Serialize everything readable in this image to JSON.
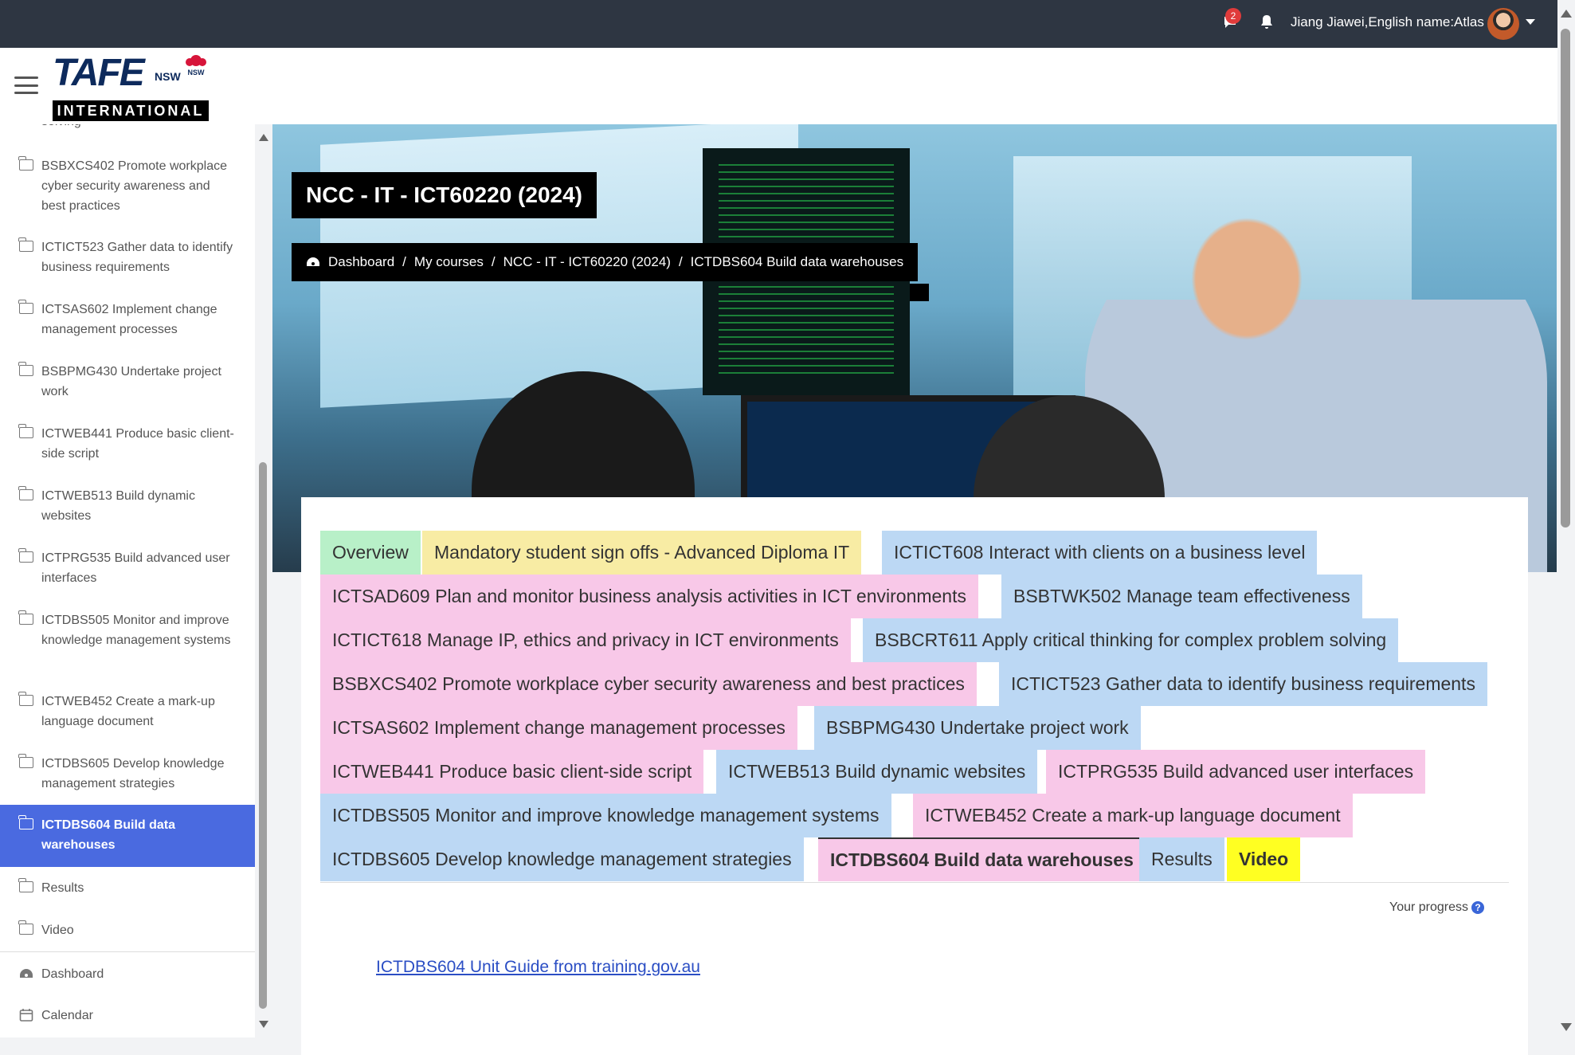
{
  "topbar": {
    "message_badge": "2",
    "user_name": "Jiang Jiawei,English name:Atlas"
  },
  "logo": {
    "brand": "TAFE",
    "nsw": "NSW",
    "international": "INTERNATIONAL"
  },
  "sidebar": {
    "cut_off_text": "solving",
    "items": [
      {
        "label": "BSBXCS402 Promote workplace cyber security awareness and best practices"
      },
      {
        "label": "ICTICT523 Gather data to identify business requirements"
      },
      {
        "label": "ICTSAS602 Implement change management processes"
      },
      {
        "label": "BSBPMG430 Undertake project work"
      },
      {
        "label": "ICTWEB441 Produce basic client-side script"
      },
      {
        "label": "ICTWEB513 Build dynamic websites"
      },
      {
        "label": "ICTPRG535 Build advanced user interfaces"
      },
      {
        "label": "ICTDBS505 Monitor and improve knowledge management systems"
      },
      {
        "label": "ICTWEB452 Create a mark-up language document"
      },
      {
        "label": "ICTDBS605 Develop knowledge management strategies"
      },
      {
        "label": "ICTDBS604 Build data warehouses"
      },
      {
        "label": "Results"
      },
      {
        "label": "Video"
      }
    ],
    "footer": [
      {
        "label": "Dashboard"
      },
      {
        "label": "Calendar"
      }
    ]
  },
  "header": {
    "course_title": "NCC - IT - ICT60220 (2024)",
    "breadcrumb": [
      "Dashboard",
      "My courses",
      "NCC - IT - ICT60220 (2024)",
      "ICTDBS604 Build data warehouses"
    ]
  },
  "tabs": [
    {
      "label": "Overview",
      "color": "#b8f0c8"
    },
    {
      "label": "Mandatory student sign offs - Advanced Diploma IT",
      "color": "#f8eca4"
    },
    {
      "label": "ICTICT608 Interact with clients on a business level",
      "color": "#bcd8f4"
    },
    {
      "label": "ICTSAD609 Plan and monitor business analysis activities in ICT environments",
      "color": "#f8c8e8"
    },
    {
      "label": "BSBTWK502 Manage team effectiveness",
      "color": "#bcd8f4"
    },
    {
      "label": "ICTICT618 Manage IP, ethics and privacy in ICT environments",
      "color": "#f8c8e8"
    },
    {
      "label": "BSBCRT611 Apply critical thinking for complex problem solving",
      "color": "#bcd8f4"
    },
    {
      "label": "BSBXCS402 Promote workplace cyber security awareness and best practices",
      "color": "#f8c8e8"
    },
    {
      "label": "ICTICT523 Gather data to identify business requirements",
      "color": "#bcd8f4"
    },
    {
      "label": "ICTSAS602 Implement change management processes",
      "color": "#f8c8e8"
    },
    {
      "label": "BSBPMG430 Undertake project work",
      "color": "#bcd8f4"
    },
    {
      "label": "ICTWEB441 Produce basic client-side script",
      "color": "#f8c8e8"
    },
    {
      "label": "ICTWEB513 Build dynamic websites",
      "color": "#bcd8f4"
    },
    {
      "label": "ICTPRG535 Build advanced user interfaces",
      "color": "#f8c8e8"
    },
    {
      "label": "ICTDBS505 Monitor and improve knowledge management systems",
      "color": "#bcd8f4"
    },
    {
      "label": "ICTWEB452 Create a mark-up language document",
      "color": "#f8c8e8"
    },
    {
      "label": "ICTDBS605 Develop knowledge management strategies",
      "color": "#bcd8f4"
    },
    {
      "label": "ICTDBS604 Build data warehouses",
      "color": "#f8c8e8"
    },
    {
      "label": "Results",
      "color": "#bcd8f4"
    },
    {
      "label": "Video",
      "color": "#ffff22"
    }
  ],
  "content": {
    "progress_label": "Your progress",
    "help_glyph": "?",
    "unit_guide_link": "ICTDBS604 Unit Guide from training.gov.au"
  },
  "colors": {
    "navbar": "#2e3642",
    "active_item": "#4a6ae0",
    "link": "#2b4ec4"
  }
}
